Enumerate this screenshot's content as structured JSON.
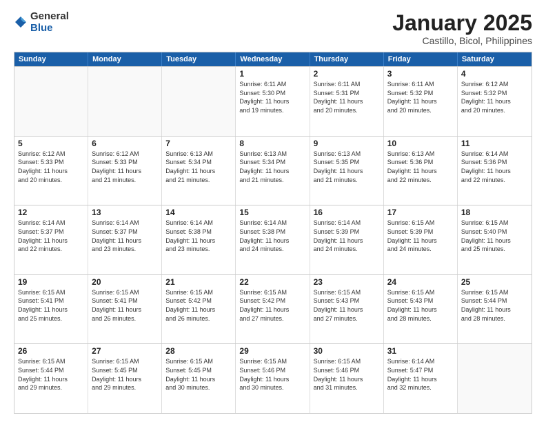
{
  "logo": {
    "general": "General",
    "blue": "Blue"
  },
  "title": "January 2025",
  "subtitle": "Castillo, Bicol, Philippines",
  "days": [
    "Sunday",
    "Monday",
    "Tuesday",
    "Wednesday",
    "Thursday",
    "Friday",
    "Saturday"
  ],
  "weeks": [
    [
      {
        "day": "",
        "info": ""
      },
      {
        "day": "",
        "info": ""
      },
      {
        "day": "",
        "info": ""
      },
      {
        "day": "1",
        "info": "Sunrise: 6:11 AM\nSunset: 5:30 PM\nDaylight: 11 hours\nand 19 minutes."
      },
      {
        "day": "2",
        "info": "Sunrise: 6:11 AM\nSunset: 5:31 PM\nDaylight: 11 hours\nand 20 minutes."
      },
      {
        "day": "3",
        "info": "Sunrise: 6:11 AM\nSunset: 5:32 PM\nDaylight: 11 hours\nand 20 minutes."
      },
      {
        "day": "4",
        "info": "Sunrise: 6:12 AM\nSunset: 5:32 PM\nDaylight: 11 hours\nand 20 minutes."
      }
    ],
    [
      {
        "day": "5",
        "info": "Sunrise: 6:12 AM\nSunset: 5:33 PM\nDaylight: 11 hours\nand 20 minutes."
      },
      {
        "day": "6",
        "info": "Sunrise: 6:12 AM\nSunset: 5:33 PM\nDaylight: 11 hours\nand 21 minutes."
      },
      {
        "day": "7",
        "info": "Sunrise: 6:13 AM\nSunset: 5:34 PM\nDaylight: 11 hours\nand 21 minutes."
      },
      {
        "day": "8",
        "info": "Sunrise: 6:13 AM\nSunset: 5:34 PM\nDaylight: 11 hours\nand 21 minutes."
      },
      {
        "day": "9",
        "info": "Sunrise: 6:13 AM\nSunset: 5:35 PM\nDaylight: 11 hours\nand 21 minutes."
      },
      {
        "day": "10",
        "info": "Sunrise: 6:13 AM\nSunset: 5:36 PM\nDaylight: 11 hours\nand 22 minutes."
      },
      {
        "day": "11",
        "info": "Sunrise: 6:14 AM\nSunset: 5:36 PM\nDaylight: 11 hours\nand 22 minutes."
      }
    ],
    [
      {
        "day": "12",
        "info": "Sunrise: 6:14 AM\nSunset: 5:37 PM\nDaylight: 11 hours\nand 22 minutes."
      },
      {
        "day": "13",
        "info": "Sunrise: 6:14 AM\nSunset: 5:37 PM\nDaylight: 11 hours\nand 23 minutes."
      },
      {
        "day": "14",
        "info": "Sunrise: 6:14 AM\nSunset: 5:38 PM\nDaylight: 11 hours\nand 23 minutes."
      },
      {
        "day": "15",
        "info": "Sunrise: 6:14 AM\nSunset: 5:38 PM\nDaylight: 11 hours\nand 24 minutes."
      },
      {
        "day": "16",
        "info": "Sunrise: 6:14 AM\nSunset: 5:39 PM\nDaylight: 11 hours\nand 24 minutes."
      },
      {
        "day": "17",
        "info": "Sunrise: 6:15 AM\nSunset: 5:39 PM\nDaylight: 11 hours\nand 24 minutes."
      },
      {
        "day": "18",
        "info": "Sunrise: 6:15 AM\nSunset: 5:40 PM\nDaylight: 11 hours\nand 25 minutes."
      }
    ],
    [
      {
        "day": "19",
        "info": "Sunrise: 6:15 AM\nSunset: 5:41 PM\nDaylight: 11 hours\nand 25 minutes."
      },
      {
        "day": "20",
        "info": "Sunrise: 6:15 AM\nSunset: 5:41 PM\nDaylight: 11 hours\nand 26 minutes."
      },
      {
        "day": "21",
        "info": "Sunrise: 6:15 AM\nSunset: 5:42 PM\nDaylight: 11 hours\nand 26 minutes."
      },
      {
        "day": "22",
        "info": "Sunrise: 6:15 AM\nSunset: 5:42 PM\nDaylight: 11 hours\nand 27 minutes."
      },
      {
        "day": "23",
        "info": "Sunrise: 6:15 AM\nSunset: 5:43 PM\nDaylight: 11 hours\nand 27 minutes."
      },
      {
        "day": "24",
        "info": "Sunrise: 6:15 AM\nSunset: 5:43 PM\nDaylight: 11 hours\nand 28 minutes."
      },
      {
        "day": "25",
        "info": "Sunrise: 6:15 AM\nSunset: 5:44 PM\nDaylight: 11 hours\nand 28 minutes."
      }
    ],
    [
      {
        "day": "26",
        "info": "Sunrise: 6:15 AM\nSunset: 5:44 PM\nDaylight: 11 hours\nand 29 minutes."
      },
      {
        "day": "27",
        "info": "Sunrise: 6:15 AM\nSunset: 5:45 PM\nDaylight: 11 hours\nand 29 minutes."
      },
      {
        "day": "28",
        "info": "Sunrise: 6:15 AM\nSunset: 5:45 PM\nDaylight: 11 hours\nand 30 minutes."
      },
      {
        "day": "29",
        "info": "Sunrise: 6:15 AM\nSunset: 5:46 PM\nDaylight: 11 hours\nand 30 minutes."
      },
      {
        "day": "30",
        "info": "Sunrise: 6:15 AM\nSunset: 5:46 PM\nDaylight: 11 hours\nand 31 minutes."
      },
      {
        "day": "31",
        "info": "Sunrise: 6:14 AM\nSunset: 5:47 PM\nDaylight: 11 hours\nand 32 minutes."
      },
      {
        "day": "",
        "info": ""
      }
    ]
  ]
}
